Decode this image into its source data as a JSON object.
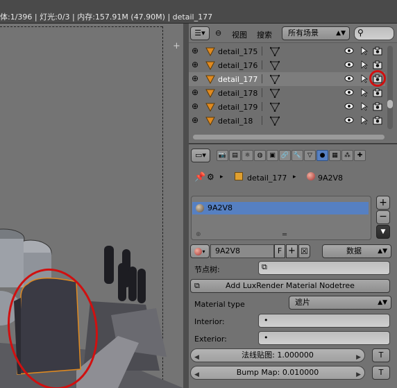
{
  "info_bar": {
    "text": "体:1/396 | 灯光:0/3 | 内存:157.91M (47.90M) | detail_177"
  },
  "viewport": {
    "highlight_color": "#d01010"
  },
  "outliner": {
    "view_menu": "视图",
    "search_menu": "搜索",
    "scene_filter": "所有场景",
    "search_placeholder": "",
    "rows": [
      {
        "name": "detail_175",
        "selected": false
      },
      {
        "name": "detail_176",
        "selected": false
      },
      {
        "name": "detail_177",
        "selected": true
      },
      {
        "name": "detail_178",
        "selected": false
      },
      {
        "name": "detail_179",
        "selected": false
      },
      {
        "name": "detail_18",
        "selected": false
      }
    ]
  },
  "properties": {
    "breadcrumb": {
      "object": "detail_177",
      "material": "9A2V8"
    },
    "material_slots": [
      {
        "name": "9A2V8"
      }
    ],
    "material_name": "9A2V8",
    "fake_user": "F",
    "data_dropdown": "数据",
    "node_tree_label": "节点树:",
    "add_nodetree_label": "Add LuxRender Material Nodetree",
    "material_type_label": "Material type",
    "material_type_value": "遮片",
    "interior_label": "Interior:",
    "exterior_label": "Exterior:",
    "normal_map_label": "法线贴图: 1.000000",
    "bump_map_label": "Bump Map: 0.010000",
    "t_label": "T"
  },
  "colors": {
    "selection_blue": "#5680c2",
    "highlight_red": "#d01010",
    "mesh_orange": "#e08a20"
  }
}
